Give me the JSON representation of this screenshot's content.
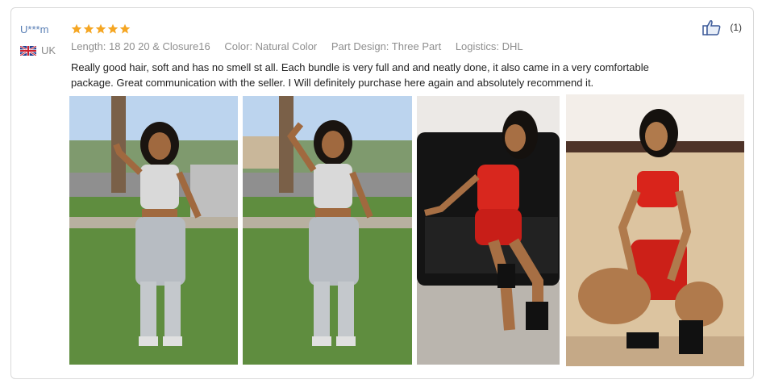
{
  "review": {
    "user": "U***m",
    "country": "UK",
    "rating": 5,
    "meta": {
      "length": "Length: 18 20 20 & Closure16",
      "color": "Color: Natural Color",
      "part_design": "Part Design: Three Part",
      "logistics": "Logistics: DHL"
    },
    "text": "Really good hair, soft and has no smell st all. Each bundle is very full and and neatly done, it also came in a very comfortable package. Great communication with the seller. I Will definitely purchase here again and absolutely recommend it.",
    "likes": "(1)"
  },
  "colors": {
    "star": "#f5a623",
    "username": "#5a7fb5",
    "meta": "#8f8f8f",
    "thumb": "#3b5998"
  },
  "photos": [
    {
      "name": "photo-1"
    },
    {
      "name": "photo-2"
    },
    {
      "name": "photo-3"
    },
    {
      "name": "photo-4"
    }
  ]
}
